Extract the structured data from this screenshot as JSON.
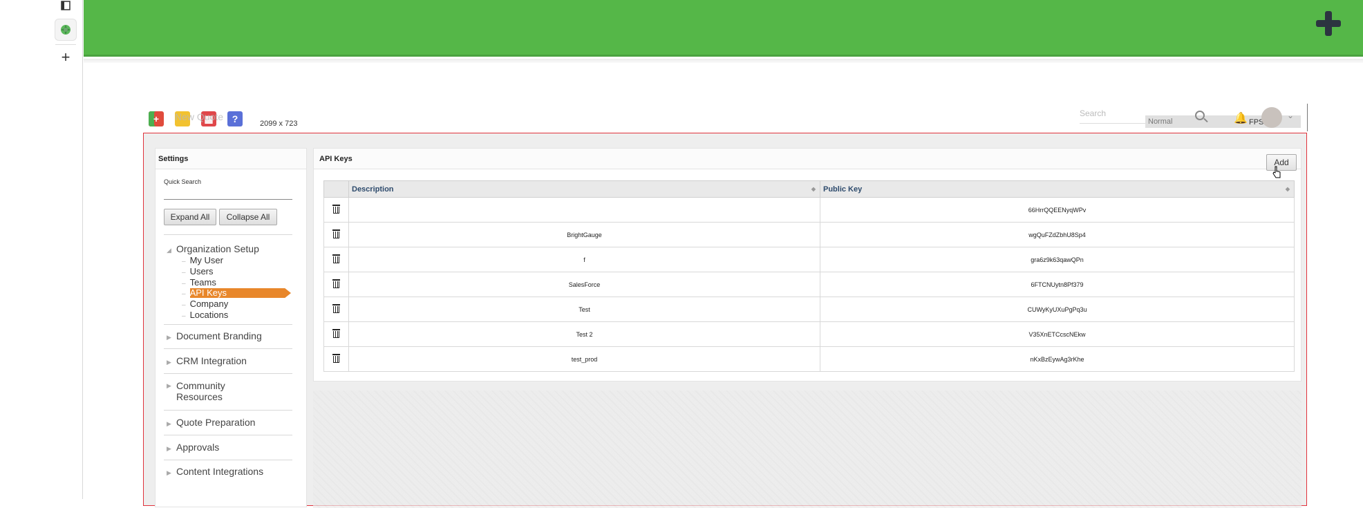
{
  "toolbar": {
    "new_quote_label": "New Quote",
    "dimensions": "2099 x 723",
    "search_placeholder": "Search",
    "normal_label": "Normal",
    "fps_label": "FPS"
  },
  "settings": {
    "title": "Settings",
    "quick_search_label": "Quick Search",
    "expand_all": "Expand All",
    "collapse_all": "Collapse All",
    "tree": [
      {
        "label": "Organization Setup",
        "expanded": true,
        "children": [
          "My User",
          "Users",
          "Teams",
          "API Keys",
          "Company",
          "Locations"
        ]
      },
      {
        "label": "Document Branding"
      },
      {
        "label": "CRM Integration"
      },
      {
        "label": "Community Resources"
      },
      {
        "label": "Quote Preparation"
      },
      {
        "label": "Approvals"
      },
      {
        "label": "Content Integrations"
      }
    ],
    "active_child": "API Keys"
  },
  "api_keys": {
    "title": "API Keys",
    "add_label": "Add",
    "columns": [
      "Description",
      "Public Key"
    ],
    "rows": [
      {
        "description": "",
        "public_key": "66HrrQQEENyqWPv"
      },
      {
        "description": "BrightGauge",
        "public_key": "wgQuFZdZbhU8Sp4"
      },
      {
        "description": "f",
        "public_key": "gra6z9k63qawQPn"
      },
      {
        "description": "SalesForce",
        "public_key": "6FTCNUytn8Pf379"
      },
      {
        "description": "Test",
        "public_key": "CUWyKyUXuPgPq3u"
      },
      {
        "description": "Test 2",
        "public_key": "V35XnETCcscNEkw"
      },
      {
        "description": "test_prod",
        "public_key": "nKxBzEywAg3rKhe"
      }
    ]
  },
  "colors": {
    "banner": "#55b748",
    "active_item": "#e8872b",
    "frame_border": "#e0303a"
  }
}
